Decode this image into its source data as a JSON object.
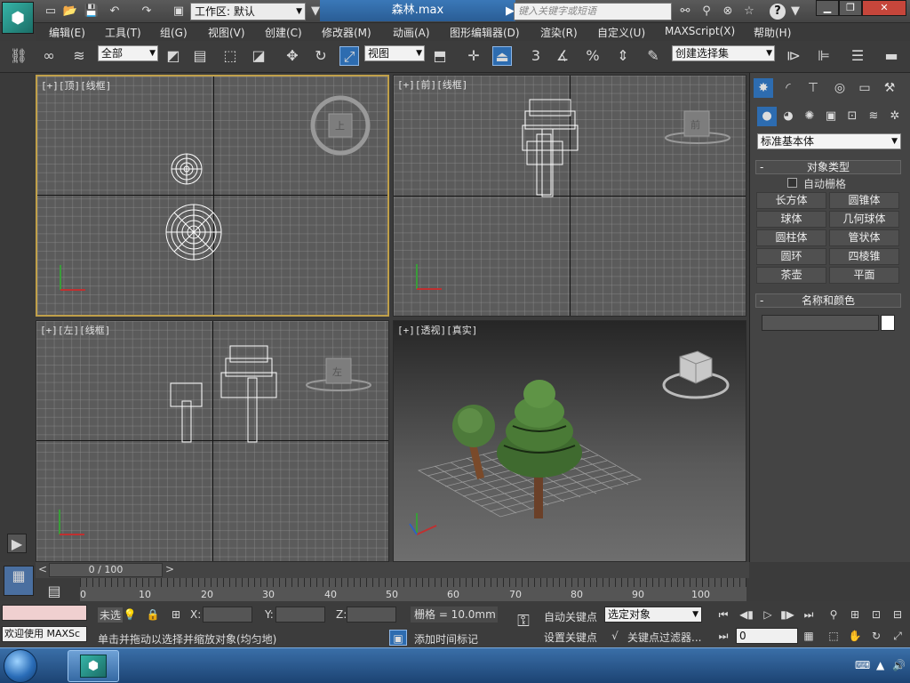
{
  "titlebar": {
    "app_logo": "3ds-max-logo",
    "workspace_label": "工作区: 默认",
    "document_title": "森林.max",
    "search_placeholder": "键入关键字或短语",
    "help_label": "?"
  },
  "menu": [
    {
      "id": "edit",
      "label": "编辑(E)"
    },
    {
      "id": "tools",
      "label": "工具(T)"
    },
    {
      "id": "group",
      "label": "组(G)"
    },
    {
      "id": "view",
      "label": "视图(V)"
    },
    {
      "id": "create",
      "label": "创建(C)"
    },
    {
      "id": "modifiers",
      "label": "修改器(M)"
    },
    {
      "id": "animation",
      "label": "动画(A)"
    },
    {
      "id": "graph-editors",
      "label": "图形编辑器(D)"
    },
    {
      "id": "rendering",
      "label": "渲染(R)"
    },
    {
      "id": "customize",
      "label": "自定义(U)"
    },
    {
      "id": "maxscript",
      "label": "MAXScript(X)"
    },
    {
      "id": "help",
      "label": "帮助(H)"
    }
  ],
  "toolbar": {
    "selection_filter": "全部",
    "ref_coord": "视图",
    "named_selection": "创建选择集",
    "snap_label": "3",
    "percent_label": "%"
  },
  "viewports": {
    "top": {
      "label": "[+][顶][线框]",
      "cube_face": "上"
    },
    "front": {
      "label": "[+][前][线框]",
      "cube_face": "前"
    },
    "left": {
      "label": "[+][左][线框]",
      "cube_face": "左"
    },
    "perspective": {
      "label": "[+][透视][真实]"
    }
  },
  "command_panel": {
    "category_dropdown": "标准基本体",
    "object_type_header": "对象类型",
    "auto_grid_label": "自动栅格",
    "object_buttons": [
      "长方体",
      "圆锥体",
      "球体",
      "几何球体",
      "圆柱体",
      "管状体",
      "圆环",
      "四棱锥",
      "茶壶",
      "平面"
    ],
    "name_color_header": "名称和颜色",
    "object_color": "#ffffff"
  },
  "timeline": {
    "slider_text": "0 / 100",
    "ticks": [
      "0",
      "10",
      "20",
      "30",
      "40",
      "50",
      "60",
      "70",
      "80",
      "90",
      "100"
    ]
  },
  "status": {
    "selected_status": "未选",
    "welcome_text": "欢迎使用 MAXSc",
    "prompt_text": "单击并拖动以选择并缩放对象(均匀地)",
    "x_label": "X:",
    "y_label": "Y:",
    "z_label": "Z:",
    "grid_text": "栅格 = 10.0mm",
    "add_time_tag": "添加时间标记",
    "auto_key": "自动关键点",
    "set_key": "设置关键点",
    "selected_object": "选定对象",
    "key_filters": "关键点过滤器...",
    "frame_value": "0"
  },
  "colors": {
    "accent_blue": "#2d6cb0",
    "active_viewport_border": "#c0a04a",
    "maxscript_field": "#f0d0d0"
  }
}
